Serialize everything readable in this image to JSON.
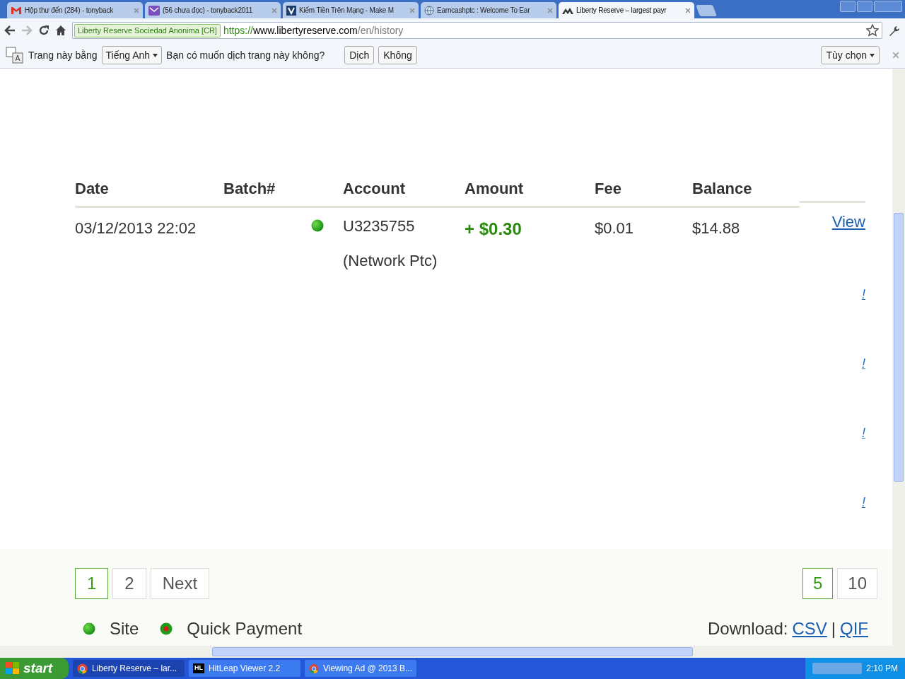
{
  "browser": {
    "tabs": [
      {
        "title": "Hộp thư đến (284) - tonyback",
        "selected": false
      },
      {
        "title": "(56 chưa đọc) - tonyback2011",
        "selected": false
      },
      {
        "title": "Kiếm Tiền Trên Mạng - Make M",
        "selected": false
      },
      {
        "title": "Earncashptc : Welcome To Ear",
        "selected": false
      },
      {
        "title": "Liberty Reserve – largest payr",
        "selected": true
      }
    ],
    "security_badge": "Liberty Reserve Sociedad Anonima [CR]",
    "url_scheme": "https://",
    "url_host": "www.libertyreserve.com",
    "url_path": "/en/history",
    "translate_bar": {
      "prefix": "Trang này bằng",
      "language": "Tiếng Anh",
      "question": "Bạn có muốn dịch trang này không?",
      "translate": "Dịch",
      "decline": "Không",
      "options": "Tùy chọn"
    }
  },
  "history": {
    "columns": [
      "Date",
      "Batch#",
      "Account",
      "Amount",
      "Fee",
      "Balance"
    ],
    "rows": [
      {
        "date": "03/12/2013 22:02",
        "batch": "",
        "kind": "site",
        "account": [
          "U3235755",
          "(Network Ptc)"
        ],
        "amount": "+ $0.30",
        "fee": "$0.01",
        "balance": "$14.88",
        "link": "View"
      }
    ],
    "cut_links": [
      "!",
      "!",
      "!",
      "!"
    ]
  },
  "pagination": {
    "pages": [
      {
        "label": "1",
        "selected": true
      },
      {
        "label": "2",
        "selected": false
      },
      {
        "label": "Next",
        "selected": false
      }
    ],
    "page_sizes": [
      {
        "label": "5",
        "selected": true
      },
      {
        "label": "10",
        "selected": false
      }
    ]
  },
  "legend": [
    {
      "kind": "site",
      "label": "Site"
    },
    {
      "kind": "quick_payment",
      "label": "Quick Payment"
    }
  ],
  "download": {
    "label": "Download:",
    "links": [
      "CSV",
      "QIF"
    ],
    "separator": "|"
  },
  "taskbar": {
    "start": "start",
    "items": [
      {
        "title": "Liberty Reserve – lar...",
        "selected": true
      },
      {
        "badge": "HL",
        "title": "HitLeap Viewer 2.2",
        "selected": false
      },
      {
        "title": "Viewing Ad @ 2013 B...",
        "selected": false
      }
    ],
    "clock": "2:10 PM"
  }
}
